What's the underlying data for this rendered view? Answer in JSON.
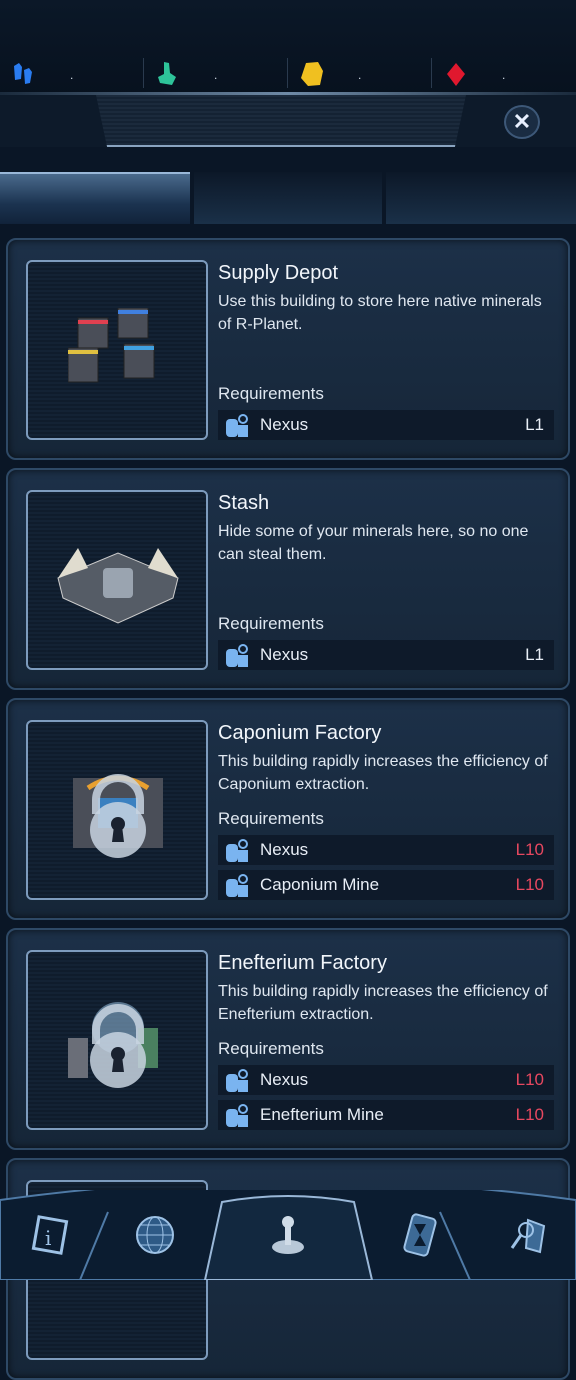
{
  "resources": [
    {
      "icon": "blue-crystal-icon",
      "value": ".",
      "color": "#2a7cf0"
    },
    {
      "icon": "green-crystal-icon",
      "value": ".",
      "color": "#2ec49a"
    },
    {
      "icon": "gold-crystal-icon",
      "value": ".",
      "color": "#f0c020"
    },
    {
      "icon": "red-crystal-icon",
      "value": ".",
      "color": "#e0182e"
    }
  ],
  "colors": {
    "accent": "#7d9bbd",
    "level_ok": "#e8eef6",
    "level_locked": "#e84860"
  },
  "buildings": [
    {
      "title": "Supply Depot",
      "description": "Use this building to store here native minerals of R-Planet.",
      "requirements_label": "Requirements",
      "locked": false,
      "requirements": [
        {
          "name": "Nexus",
          "level": "L1",
          "met": true
        }
      ]
    },
    {
      "title": "Stash",
      "description": "Hide some of your minerals here, so no one can steal them.",
      "requirements_label": "Requirements",
      "locked": false,
      "requirements": [
        {
          "name": "Nexus",
          "level": "L1",
          "met": true
        }
      ]
    },
    {
      "title": "Caponium Factory",
      "description": "This building rapidly increases the efficiency of Caponium extraction.",
      "requirements_label": "Requirements",
      "locked": true,
      "requirements": [
        {
          "name": "Nexus",
          "level": "L10",
          "met": false
        },
        {
          "name": "Caponium Mine",
          "level": "L10",
          "met": false
        }
      ]
    },
    {
      "title": "Enefterium Factory",
      "description": "This building rapidly increases the efficiency of Enefterium extraction.",
      "requirements_label": "Requirements",
      "locked": true,
      "requirements": [
        {
          "name": "Nexus",
          "level": "L10",
          "met": false
        },
        {
          "name": "Enefterium Mine",
          "level": "L10",
          "met": false
        }
      ]
    }
  ],
  "nav": [
    {
      "icon": "info-icon"
    },
    {
      "icon": "globe-icon"
    },
    {
      "icon": "joystick-icon",
      "active": true
    },
    {
      "icon": "hourglass-icon"
    },
    {
      "icon": "research-icon"
    }
  ]
}
